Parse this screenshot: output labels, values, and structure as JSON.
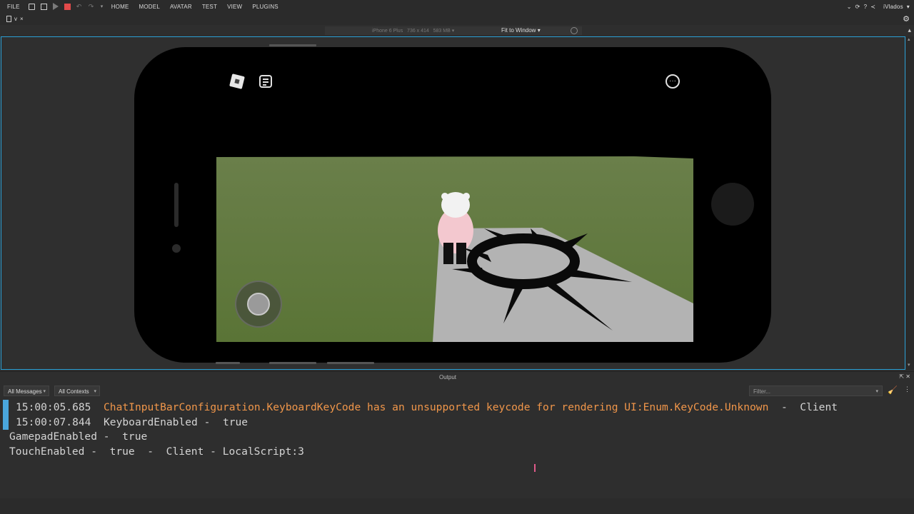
{
  "menubar": {
    "items": [
      "FILE",
      "HOME",
      "MODEL",
      "AVATAR",
      "TEST",
      "VIEW",
      "PLUGINS"
    ],
    "user": "iVlados",
    "icons": [
      "file-icon",
      "save-icon",
      "play-icon",
      "stop-icon",
      "undo-icon",
      "redo-icon",
      "share-icon",
      "help-icon",
      "notification-icon"
    ]
  },
  "tabs": {
    "doc_tab_label": "v",
    "close_glyph": "×"
  },
  "device_bar": {
    "device": "iPhone 6 Plus",
    "resolution": "736 x 414",
    "memory": "583 MB",
    "fit_label": "Fit to Window"
  },
  "output": {
    "title": "Output",
    "messages_filter": "All Messages",
    "contexts_filter": "All Contexts",
    "filter_placeholder": "Filter...",
    "log": [
      {
        "time": "15:00:05.685",
        "text": "ChatInputBarConfiguration.KeyboardKeyCode has an unsupported keycode for rendering UI:Enum.KeyCode.Unknown",
        "suffix": "-  Client",
        "level": "warning"
      },
      {
        "time": "15:00:07.844",
        "text": "KeyboardEnabled -  true",
        "level": "info"
      },
      {
        "text": "GamepadEnabled -  true",
        "level": "info"
      },
      {
        "text": "TouchEnabled -  true  -  Client - LocalScript:3",
        "level": "info"
      }
    ]
  },
  "colors": {
    "accent": "#2aa0d6",
    "warning": "#f0964a",
    "stop": "#e24a4a",
    "grass": "#5e7a3c",
    "baseplate_tile": "#b5b5b5"
  }
}
